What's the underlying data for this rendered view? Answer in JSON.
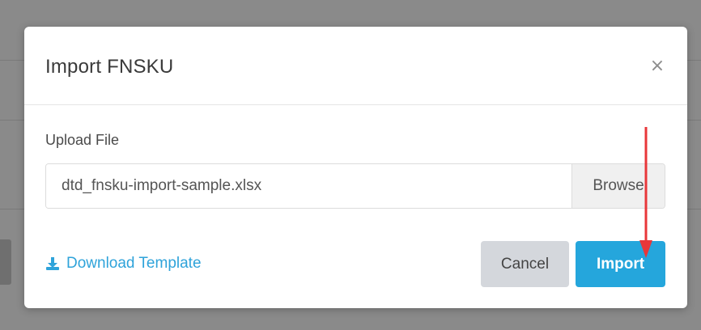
{
  "dialog": {
    "title": "Import FNSKU",
    "close_icon": "close-icon",
    "close_glyph": "×"
  },
  "upload": {
    "label": "Upload File",
    "file_value": "dtd_fnsku-import-sample.xlsx",
    "browse_label": "Browse"
  },
  "footer": {
    "download_label": "Download Template",
    "download_icon": "download-icon",
    "cancel_label": "Cancel",
    "import_label": "Import"
  },
  "colors": {
    "accent": "#25a6dc",
    "link": "#2fa3da",
    "cancel_bg": "#d4d7dc",
    "annotation_arrow": "#e8373a"
  }
}
